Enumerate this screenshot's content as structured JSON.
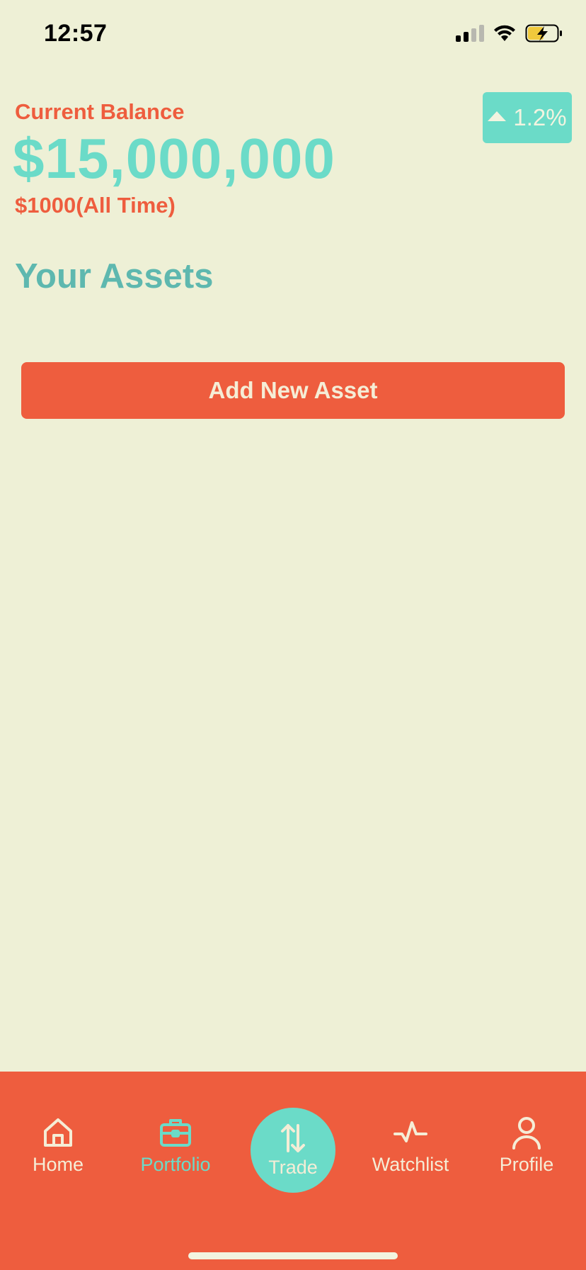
{
  "status_bar": {
    "time": "12:57",
    "icons": [
      "cellular-signal-icon",
      "wifi-icon",
      "battery-charging-icon"
    ]
  },
  "balance": {
    "label": "Current Balance",
    "value": "$15,000,000",
    "all_time": "$1000(All Time)",
    "change": "1.2%",
    "change_direction_icon": "triangle-up-icon"
  },
  "assets": {
    "title": "Your Assets",
    "add_button_label": "Add New Asset"
  },
  "tab_bar": {
    "items": [
      {
        "label": "Home",
        "icon": "home-icon"
      },
      {
        "label": "Portfolio",
        "icon": "briefcase-icon",
        "active": true
      },
      {
        "label": "Trade",
        "icon": "swap-arrows-icon"
      },
      {
        "label": "Watchlist",
        "icon": "activity-icon"
      },
      {
        "label": "Profile",
        "icon": "user-icon"
      }
    ]
  },
  "colors": {
    "background": "#EEF0D6",
    "primary_orange": "#EE5D3E",
    "accent_teal": "#6BDBC8",
    "teal_dark": "#5EB8AF",
    "cream": "#F5EDD6"
  }
}
